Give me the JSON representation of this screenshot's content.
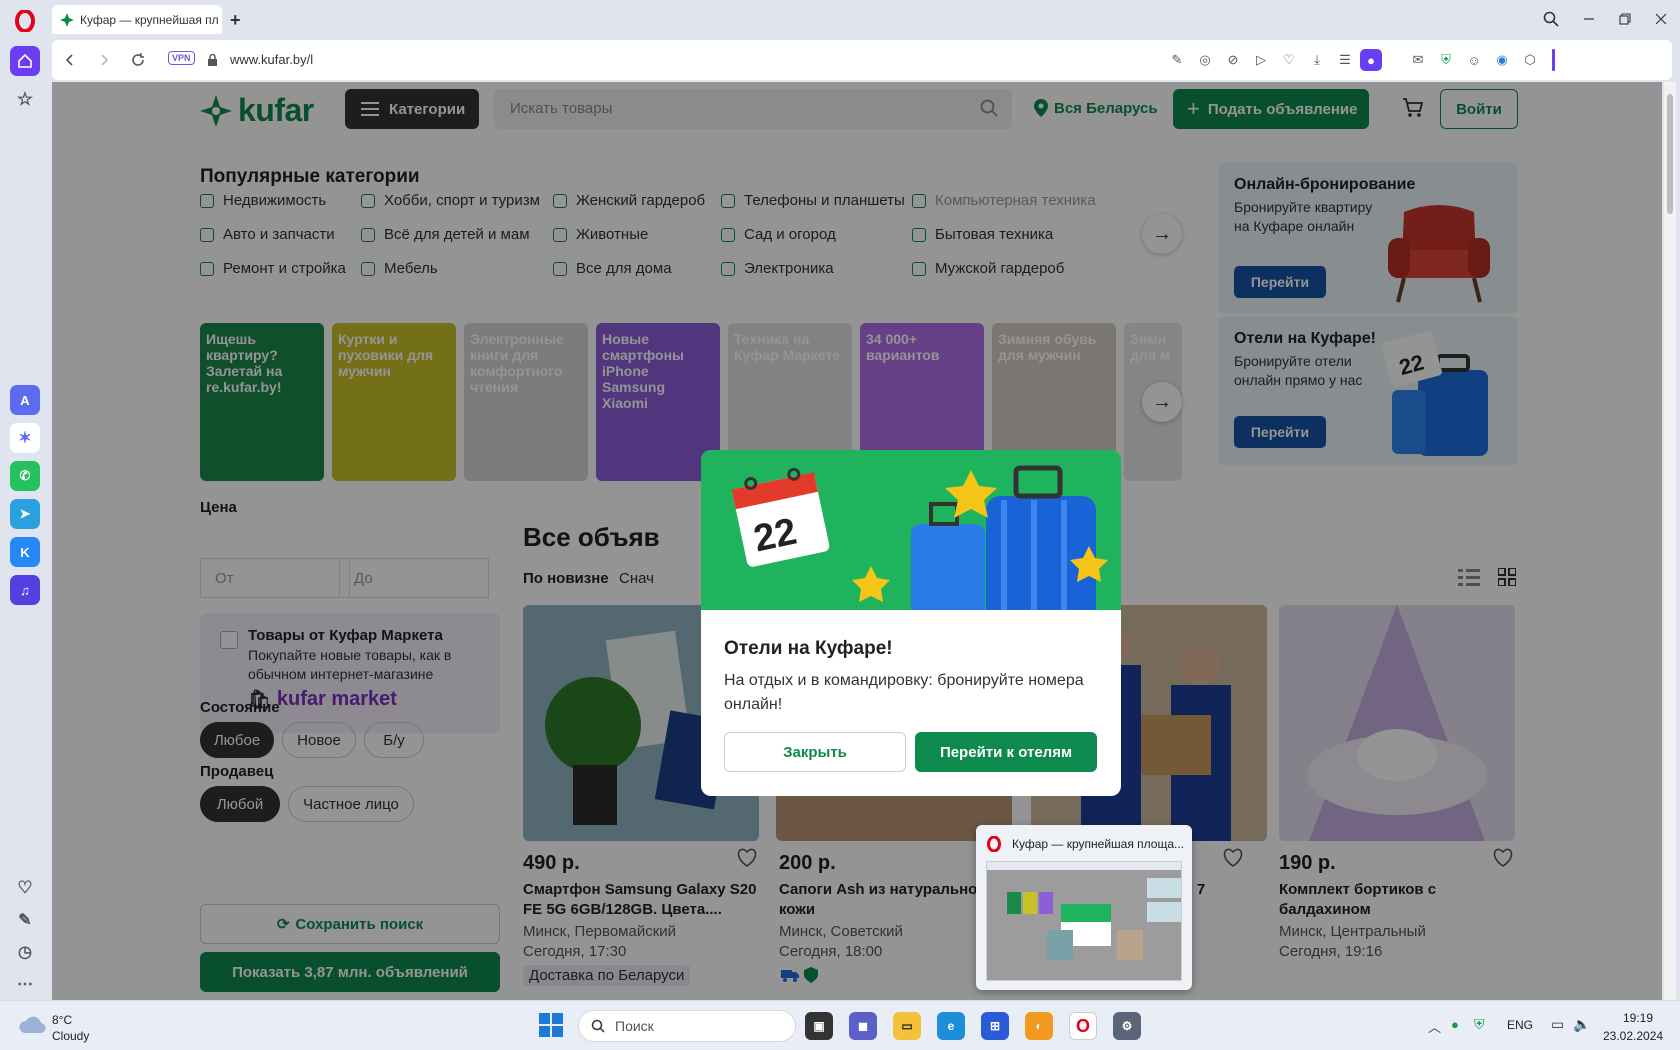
{
  "browser": {
    "tab_title": "Куфар — крупнейшая пл",
    "url": "www.kufar.by/l",
    "vpn_label": "VPN"
  },
  "header": {
    "logo_text": "kufar",
    "categories_button": "Категории",
    "search_placeholder": "Искать товары",
    "region": "Вся Беларусь",
    "post_ad_button": "Подать объявление",
    "login_button": "Войти"
  },
  "popular": {
    "title": "Популярные категории",
    "items": [
      "Недвижимость",
      "Хобби, спорт и туризм",
      "Женский гардероб",
      "Телефоны и планшеты",
      "Компьютерная техника",
      "Авто и запчасти",
      "Всё для детей и мам",
      "Животные",
      "Сад и огород",
      "Бытовая техника",
      "Ремонт и стройка",
      "Мебель",
      "Все для дома",
      "Электроника",
      "Мужской гардероб"
    ]
  },
  "banners": [
    {
      "text": "Ищешь квартиру? Залетай на re.kufar.by!",
      "color": "#1a8a4a"
    },
    {
      "text": "Куртки и пуховики для мужчин",
      "color": "#c8c22a"
    },
    {
      "text": "Электронные книги для комфортного чтения",
      "color": "#d6d6d6"
    },
    {
      "text": "Новые смартфоны iPhone Samsung Xiaomi",
      "color": "#8e5ed8"
    },
    {
      "text": "Техника на Куфар Маркете",
      "color": "#e0e0e0"
    },
    {
      "text": "34 000+ вариантов",
      "color": "#b06fe8"
    },
    {
      "text": "Зимняя обувь для мужчин",
      "color": "#d2ccc4"
    },
    {
      "text": "Зимн для м",
      "color": "#e5e5e5"
    }
  ],
  "promos": [
    {
      "title": "Онлайн-бронирование",
      "text": "Бронируйте квартиру на Куфаре онлайн",
      "button": "Перейти"
    },
    {
      "title": "Отели на Куфаре!",
      "text": "Бронируйте отели онлайн прямо у нас",
      "button": "Перейти"
    }
  ],
  "filters": {
    "price_label": "Цена",
    "price_from": "От",
    "price_to": "До",
    "market_title": "Товары от Куфар Маркета",
    "market_text": "Покупайте новые товары, как в обычном интернет-магазине",
    "market_logo": "kufar market",
    "condition_label": "Состояние",
    "condition_options": [
      "Любое",
      "Новое",
      "Б/у"
    ],
    "seller_label": "Продавец",
    "seller_options": [
      "Любой",
      "Частное лицо"
    ],
    "save_search": "Сохранить поиск",
    "show_button": "Показать 3,87 млн. объявлений"
  },
  "listing": {
    "title": "Все объяв",
    "sort_new": "По новизне",
    "sort_other": "Снач",
    "cards": [
      {
        "price": "490 р.",
        "title": "Смартфон Samsung Galaxy S20 FE 5G 6GB/128GB. Цвета....",
        "location": "Минск, Первомайский",
        "time": "Сегодня, 17:30",
        "badge": "Доставка по Беларуси"
      },
      {
        "price": "200 р.",
        "title": "Сапоги Ash из натуральной кожи",
        "location": "Минск, Советский",
        "time": "Сегодня, 18:00"
      },
      {
        "price": "",
        "title": "азать 7",
        "location": "",
        "time": ""
      },
      {
        "price": "190 р.",
        "title": "Комплект бортиков с балдахином",
        "location": "Минск, Центральный",
        "time": "Сегодня, 19:16"
      }
    ]
  },
  "modal": {
    "title": "Отели на Куфаре!",
    "text": "На отдых и в командировку: бронируйте номера онлайн!",
    "calendar_day": "22",
    "close_button": "Закрыть",
    "go_button": "Перейти к отелям"
  },
  "thumbnail": {
    "title": "Куфар — крупнейшая площа..."
  },
  "taskbar": {
    "temperature": "8°C",
    "weather": "Cloudy",
    "search_label": "Поиск",
    "language": "ENG",
    "time": "19:19",
    "date": "23.02.2024"
  }
}
